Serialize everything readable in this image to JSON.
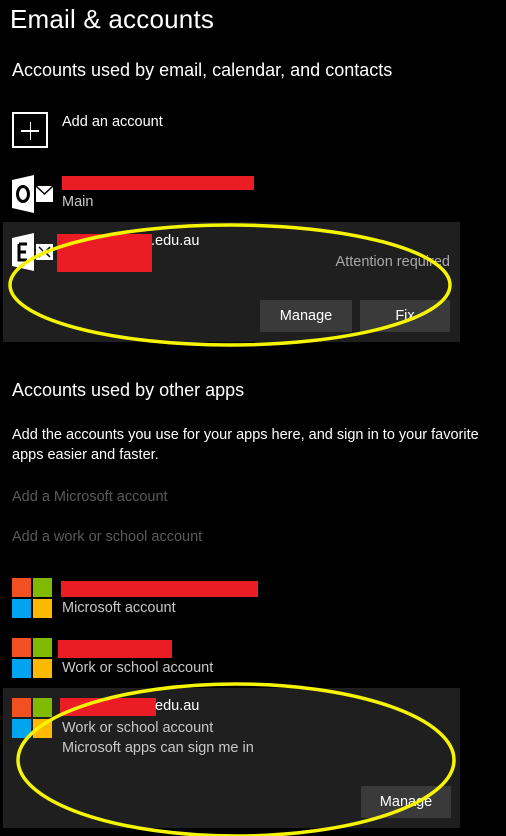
{
  "page": {
    "title": "Email & accounts"
  },
  "email_section": {
    "title": "Accounts used by email, calendar, and contacts",
    "add_account_label": "Add an account",
    "accounts": [
      {
        "icon": "outlook-icon",
        "subtitle": "Main"
      },
      {
        "icon": "exchange-icon",
        "email_suffix": ".edu.au",
        "status": "Attention required",
        "manage_label": "Manage",
        "fix_label": "Fix"
      }
    ]
  },
  "other_apps_section": {
    "title": "Accounts used by other apps",
    "description": "Add the accounts you use for your apps here, and sign in to your favorite apps easier and faster.",
    "add_microsoft_link": "Add a Microsoft account",
    "add_work_link": "Add a work or school account",
    "accounts": [
      {
        "icon": "microsoft-logo-icon",
        "subtitle": "Microsoft account"
      },
      {
        "icon": "microsoft-logo-icon",
        "subtitle": "Work or school account"
      },
      {
        "icon": "microsoft-logo-icon",
        "email_suffix": "edu.au",
        "subtitle": "Work or school account",
        "note": "Microsoft apps can sign me in",
        "manage_label": "Manage"
      }
    ]
  },
  "colors": {
    "background": "#000000",
    "panel": "#1f1f1f",
    "button": "#3a3a3a",
    "redaction": "#ec1c24",
    "highlight": "#f5f500",
    "disabled_text": "#5a5a5a"
  }
}
